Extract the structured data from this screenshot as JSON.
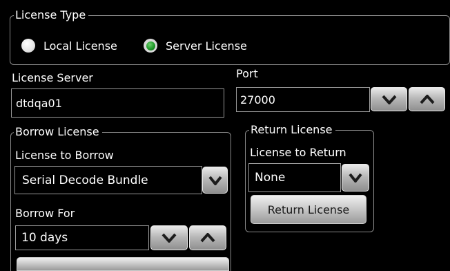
{
  "license_type": {
    "legend": "License Type",
    "options": [
      {
        "label": "Local License",
        "selected": false
      },
      {
        "label": "Server License",
        "selected": true
      }
    ]
  },
  "license_server": {
    "label": "License Server",
    "value": "dtdqa01"
  },
  "port": {
    "label": "Port",
    "value": "27000"
  },
  "borrow": {
    "legend": "Borrow License",
    "license_label": "License to Borrow",
    "license_value": "Serial Decode Bundle",
    "for_label": "Borrow For",
    "for_value": "10 days"
  },
  "return": {
    "legend": "Return License",
    "license_label": "License to Return",
    "license_value": "None",
    "button_label": "Return License"
  },
  "icons": {
    "down": "chevron-down-icon",
    "up": "chevron-up-icon"
  },
  "colors": {
    "accent_selected": "#1f9a2a",
    "background": "#000000",
    "button_face": "#c0c0c0"
  }
}
